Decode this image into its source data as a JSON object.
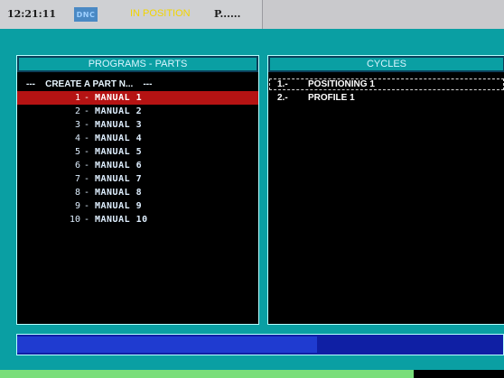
{
  "topbar": {
    "clock": "12:21:11",
    "mode_badge": "DNC",
    "status": "IN POSITION",
    "program": "P......"
  },
  "programs_panel": {
    "title": "PROGRAMS - PARTS",
    "create_label": "---    CREATE A PART N...    ---",
    "items": [
      {
        "num": "1",
        "sep": "-",
        "name": "MANUAL 1",
        "selected": true
      },
      {
        "num": "2",
        "sep": "-",
        "name": "MANUAL 2"
      },
      {
        "num": "3",
        "sep": "-",
        "name": "MANUAL 3"
      },
      {
        "num": "4",
        "sep": "-",
        "name": "MANUAL 4"
      },
      {
        "num": "5",
        "sep": "-",
        "name": "MANUAL 5"
      },
      {
        "num": "6",
        "sep": "-",
        "name": "MANUAL 6"
      },
      {
        "num": "7",
        "sep": "-",
        "name": "MANUAL 7"
      },
      {
        "num": "8",
        "sep": "-",
        "name": "MANUAL 8"
      },
      {
        "num": "9",
        "sep": "-",
        "name": "MANUAL 9"
      },
      {
        "num": "10",
        "sep": "-",
        "name": "MANUAL 10"
      }
    ]
  },
  "cycles_panel": {
    "title": "CYCLES",
    "items": [
      {
        "num": "1.-",
        "name": "POSITIONING 1",
        "selected": true
      },
      {
        "num": "2.-",
        "name": "PROFILE 1"
      }
    ]
  },
  "colors": {
    "background": "#0a9fa3",
    "selection": "#b51313",
    "message_bar": "#0f1fa4",
    "status_text": "#f2d400"
  }
}
